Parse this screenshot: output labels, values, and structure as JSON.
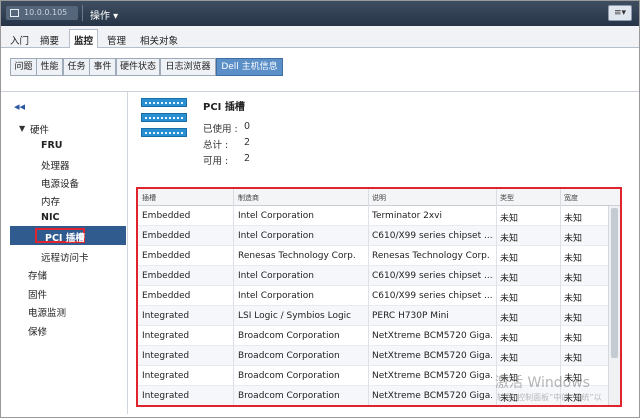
{
  "titlebar": {
    "host": "10.0.0.105",
    "actions_label": "操作 ▾",
    "menu_icon": "≡▾"
  },
  "tabs": [
    "入门",
    "摘要",
    "监控",
    "管理",
    "相关对象"
  ],
  "subtabs": [
    "问题",
    "性能",
    "任务",
    "事件",
    "硬件状态",
    "日志浏览器",
    "Dell 主机信息"
  ],
  "sidebar": {
    "collapse_icon": "◂◂",
    "hardware_label": "硬件",
    "items": [
      "FRU",
      "处理器",
      "电源设备",
      "内存",
      "NIC",
      "PCI 插槽",
      "远程访问卡"
    ],
    "top_items": [
      "存储",
      "固件",
      "电源监测",
      "保修"
    ]
  },
  "pci": {
    "title": "PCI 插槽",
    "stats": [
      {
        "label": "已使用 :",
        "value": "0"
      },
      {
        "label": "总计 :",
        "value": "2"
      },
      {
        "label": "可用 :",
        "value": "2"
      }
    ]
  },
  "table": {
    "headers": [
      "插槽",
      "制造商",
      "说明",
      "类型",
      "宽度"
    ],
    "rows": [
      [
        "Embedded",
        "Intel Corporation",
        "Terminator 2xvi",
        "未知",
        "未知"
      ],
      [
        "Embedded",
        "Intel Corporation",
        "C610/X99 series chipset ...",
        "未知",
        "未知"
      ],
      [
        "Embedded",
        "Renesas Technology Corp.",
        "Renesas Technology Corp.",
        "未知",
        "未知"
      ],
      [
        "Embedded",
        "Intel Corporation",
        "C610/X99 series chipset ...",
        "未知",
        "未知"
      ],
      [
        "Embedded",
        "Intel Corporation",
        "C610/X99 series chipset ...",
        "未知",
        "未知"
      ],
      [
        "Integrated",
        "LSI Logic / Symbios Logic",
        "PERC H730P Mini",
        "未知",
        "未知"
      ],
      [
        "Integrated",
        "Broadcom Corporation",
        "NetXtreme BCM5720 Giga...",
        "未知",
        "未知"
      ],
      [
        "Integrated",
        "Broadcom Corporation",
        "NetXtreme BCM5720 Giga...",
        "未知",
        "未知"
      ],
      [
        "Integrated",
        "Broadcom Corporation",
        "NetXtreme BCM5720 Giga...",
        "未知",
        "未知"
      ],
      [
        "Integrated",
        "Broadcom Corporation",
        "NetXtreme BCM5720 Giga...",
        "未知",
        "未知"
      ]
    ]
  },
  "watermark": {
    "line1": "激活 Windows",
    "line2": "转到“控制面板”中的“系统”以"
  },
  "colors": {
    "accent": "#2f5b8f",
    "highlight": "#e0242e",
    "active_tab": "#5b8fc8"
  }
}
